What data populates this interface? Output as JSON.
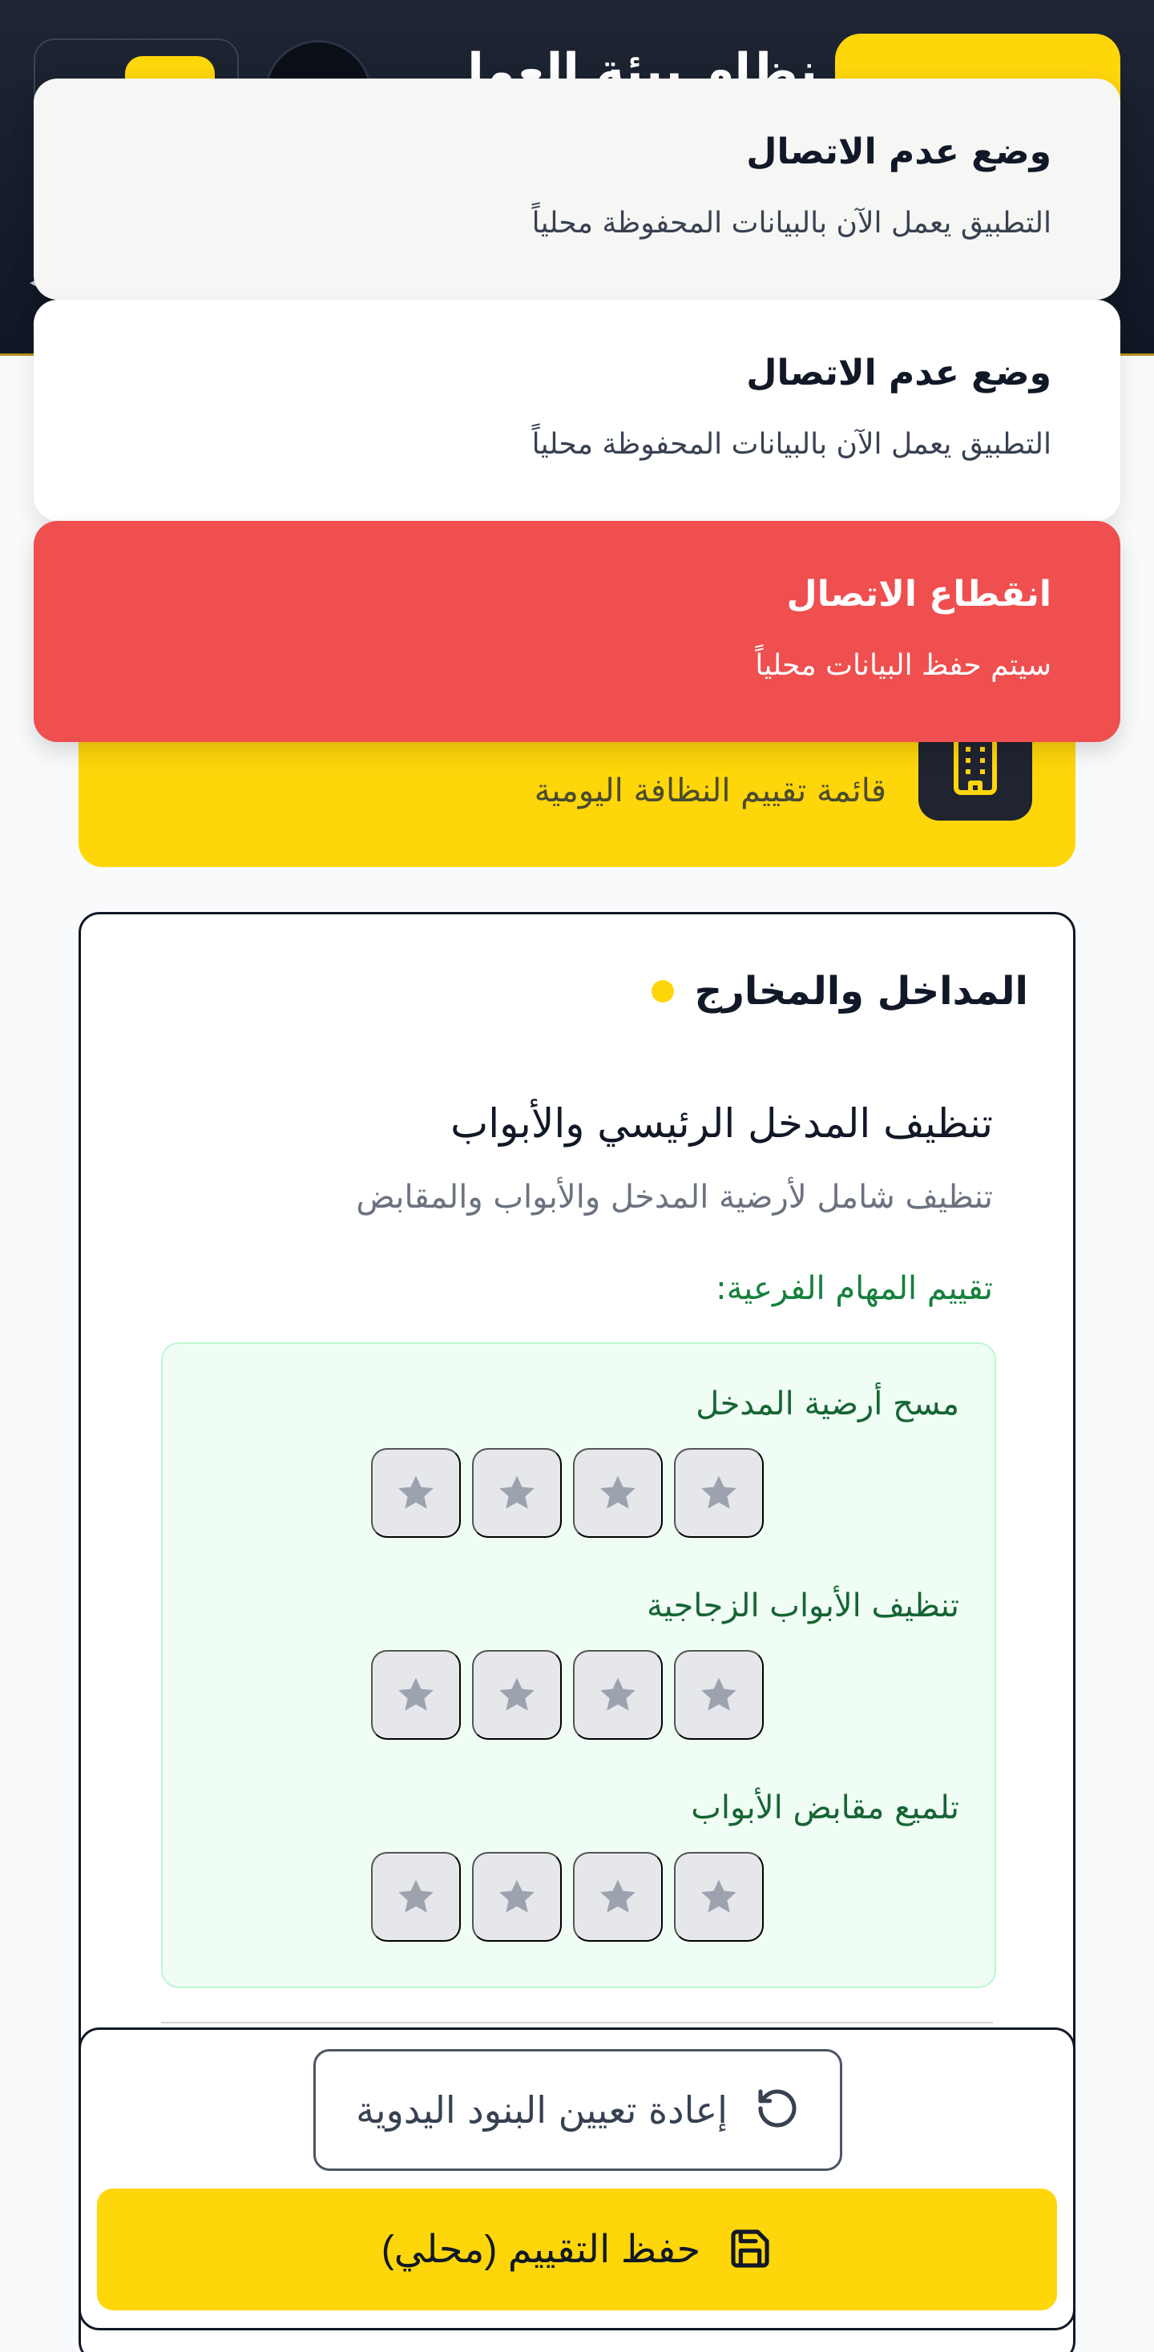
{
  "colors": {
    "accent": "#ffd60a",
    "header_bg": "#1e2533",
    "toast_error": "#ef4f4f",
    "subtask_bg": "#f0fdf4",
    "subtask_text": "#15803d",
    "star_inactive": "#9ca3af"
  },
  "header": {
    "title": "نظام بيئة العمل"
  },
  "intro": {
    "subtitle": "قائمة تقييم النظافة اليومية",
    "icon": "building-icon"
  },
  "section": {
    "title": "المداخل والمخارج",
    "task": {
      "title": "تنظيف المدخل الرئيسي والأبواب",
      "description": "تنظيف شامل لأرضية المدخل والأبواب والمقابض",
      "subtasks_label": "تقييم المهام الفرعية:",
      "subtasks": [
        {
          "name": "مسح أرضية المدخل",
          "rating": 0,
          "max": 4
        },
        {
          "name": "تنظيف الأبواب الزجاجية",
          "rating": 0,
          "max": 4
        },
        {
          "name": "تلميع مقابض الأبواب",
          "rating": 0,
          "max": 4
        }
      ]
    }
  },
  "actions": {
    "reset_label": "إعادة تعيين البنود اليدوية",
    "reset_icon": "rotate-ccw-icon",
    "save_label": "حفظ التقييم (محلي)",
    "save_icon": "save-icon"
  },
  "toasts": [
    {
      "title": "وضع عدم الاتصال",
      "description": "التطبيق يعمل الآن بالبيانات المحفوظة محلياً",
      "variant": "default"
    },
    {
      "title": "وضع عدم الاتصال",
      "description": "التطبيق يعمل الآن بالبيانات المحفوظة محلياً",
      "variant": "default"
    },
    {
      "title": "انقطاع الاتصال",
      "description": "سيتم حفظ البيانات محلياً",
      "variant": "destructive"
    }
  ]
}
